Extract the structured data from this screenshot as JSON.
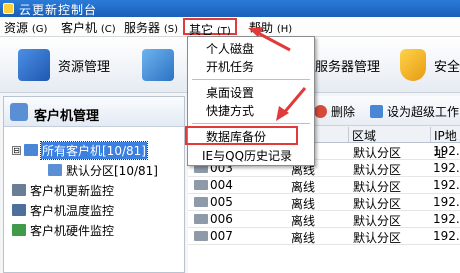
{
  "window": {
    "title": "云更新控制台"
  },
  "menubar": {
    "items": [
      {
        "label": "资源",
        "accel": "(G)"
      },
      {
        "label": "客户机",
        "accel": "(C)"
      },
      {
        "label": "服务器",
        "accel": "(S)"
      },
      {
        "label": "其它",
        "accel": "(T)"
      },
      {
        "label": "帮助",
        "accel": "(H)"
      }
    ]
  },
  "toolbar": {
    "items": [
      {
        "label": "资源管理"
      },
      {
        "label": "服务器管理"
      },
      {
        "label": "安全"
      }
    ]
  },
  "dropdown": {
    "items": [
      {
        "label": "个人磁盘"
      },
      {
        "label": "开机任务"
      },
      {
        "label": "桌面设置"
      },
      {
        "label": "快捷方式"
      },
      {
        "label": "数据库备份"
      },
      {
        "label": "IE与QQ历史记录"
      }
    ]
  },
  "left_panel": {
    "header": "客户机管理",
    "tree": [
      {
        "label": "所有客户机[10/81]",
        "expander": "⊟"
      },
      {
        "label": "默认分区[10/81]"
      },
      {
        "label": "客户机更新监控"
      },
      {
        "label": "客户机温度监控"
      },
      {
        "label": "客户机硬件监控"
      }
    ]
  },
  "right_panel": {
    "toolbar": {
      "delete_label": "删除",
      "super_label": "设为超级工作"
    },
    "grid": {
      "headers": [
        "区域",
        "IP地址"
      ],
      "rows": [
        {
          "name": "",
          "status": "",
          "zone": "默认分区",
          "ip": "192.1"
        },
        {
          "name": "003",
          "status": "离线",
          "zone": "默认分区",
          "ip": "192.1"
        },
        {
          "name": "004",
          "status": "离线",
          "zone": "默认分区",
          "ip": "192.1"
        },
        {
          "name": "005",
          "status": "离线",
          "zone": "默认分区",
          "ip": "192.1"
        },
        {
          "name": "006",
          "status": "离线",
          "zone": "默认分区",
          "ip": "192.1"
        },
        {
          "name": "007",
          "status": "离线",
          "zone": "默认分区",
          "ip": "192.1"
        }
      ]
    }
  },
  "colors": {
    "highlight": "#e03a3a",
    "selection": "#3b7fe0",
    "titlebar": "#2a7bd8"
  }
}
